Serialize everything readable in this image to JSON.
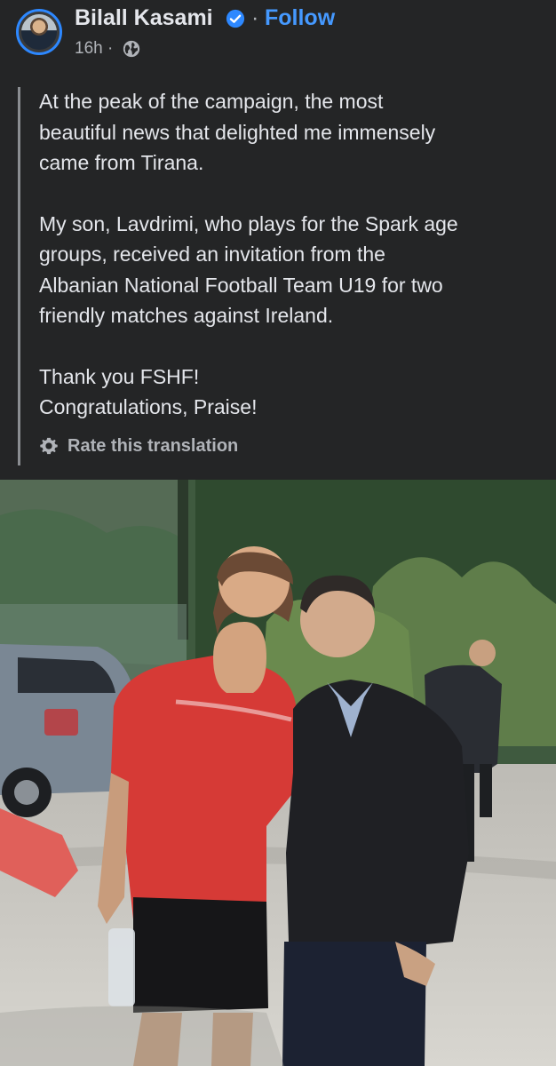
{
  "post": {
    "author": "Bilall Kasami",
    "follow_label": "Follow",
    "separator": "·",
    "time": "16h ·",
    "verified": true,
    "paragraphs": [
      [
        "At the peak of the campaign, the most",
        "beautiful news that delighted me immensely",
        "came from Tirana."
      ],
      [
        "My son, Lavdrimi, who plays for the Spark age",
        "groups, received an invitation from the",
        "Albanian National Football Team U19 for two",
        "friendly matches against Ireland."
      ],
      [
        "Thank you FSHF!",
        "Congratulations, Praise!"
      ]
    ],
    "rate_translation_label": "Rate this translation"
  },
  "colors": {
    "background": "#242526",
    "text": "#e4e6eb",
    "secondary_text": "#b0b3b8",
    "link": "#4599ff",
    "verified_badge": "#2d88ff"
  },
  "icons": {
    "verified": "verified-badge-icon",
    "audience": "globe-icon",
    "translation": "gear-icon"
  },
  "photo": {
    "subject": "photo-two-people-outdoors"
  }
}
